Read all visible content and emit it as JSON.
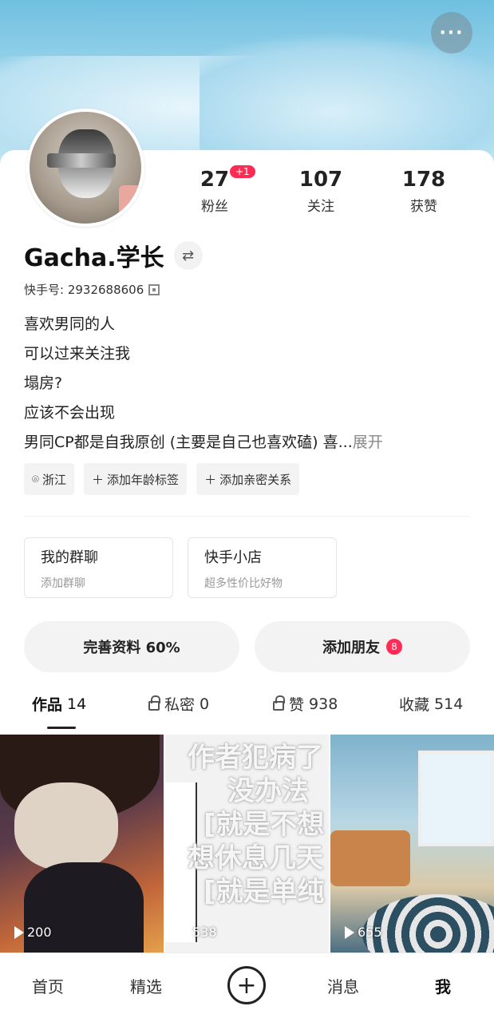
{
  "header": {
    "more_label": "···"
  },
  "profile": {
    "name": "Gacha.学长",
    "uid_label": "快手号: 2932688606",
    "stats": [
      {
        "num": "27",
        "label": "粉丝",
        "badge": "+1"
      },
      {
        "num": "107",
        "label": "关注"
      },
      {
        "num": "178",
        "label": "获赞"
      }
    ],
    "bio_lines": [
      "喜欢男同的人",
      "可以过来关注我",
      "塌房?",
      "应该不会出现",
      "男同CP都是自我原创 (主要是自己也喜欢磕) 喜..."
    ],
    "bio_expand": "展开",
    "tags": [
      "浙江",
      "添加年龄标签",
      "添加亲密关系"
    ]
  },
  "boxes": [
    {
      "title": "我的群聊",
      "subtitle": "添加群聊"
    },
    {
      "title": "快手小店",
      "subtitle": "超多性价比好物"
    }
  ],
  "actions": {
    "complete_profile": "完善资料 60%",
    "add_friends": "添加朋友",
    "add_friends_badge": "8"
  },
  "tabs": [
    {
      "label": "作品",
      "count": "14"
    },
    {
      "label": "私密",
      "count": "0"
    },
    {
      "label": "赞",
      "count": "938"
    },
    {
      "label": "收藏",
      "count": "514"
    }
  ],
  "videos": [
    {
      "views": "200"
    },
    {
      "views": "538",
      "overlay_lines": [
        "作者犯病了",
        "没办法",
        "[就是不想",
        "想休息几天",
        "[就是单纯"
      ]
    },
    {
      "views": "655"
    }
  ],
  "nav": {
    "home": "首页",
    "featured": "精选",
    "add": "+",
    "messages": "消息",
    "me": "我"
  },
  "colors": {
    "accent": "#fe2c55",
    "banner": "#9fd6ec"
  }
}
